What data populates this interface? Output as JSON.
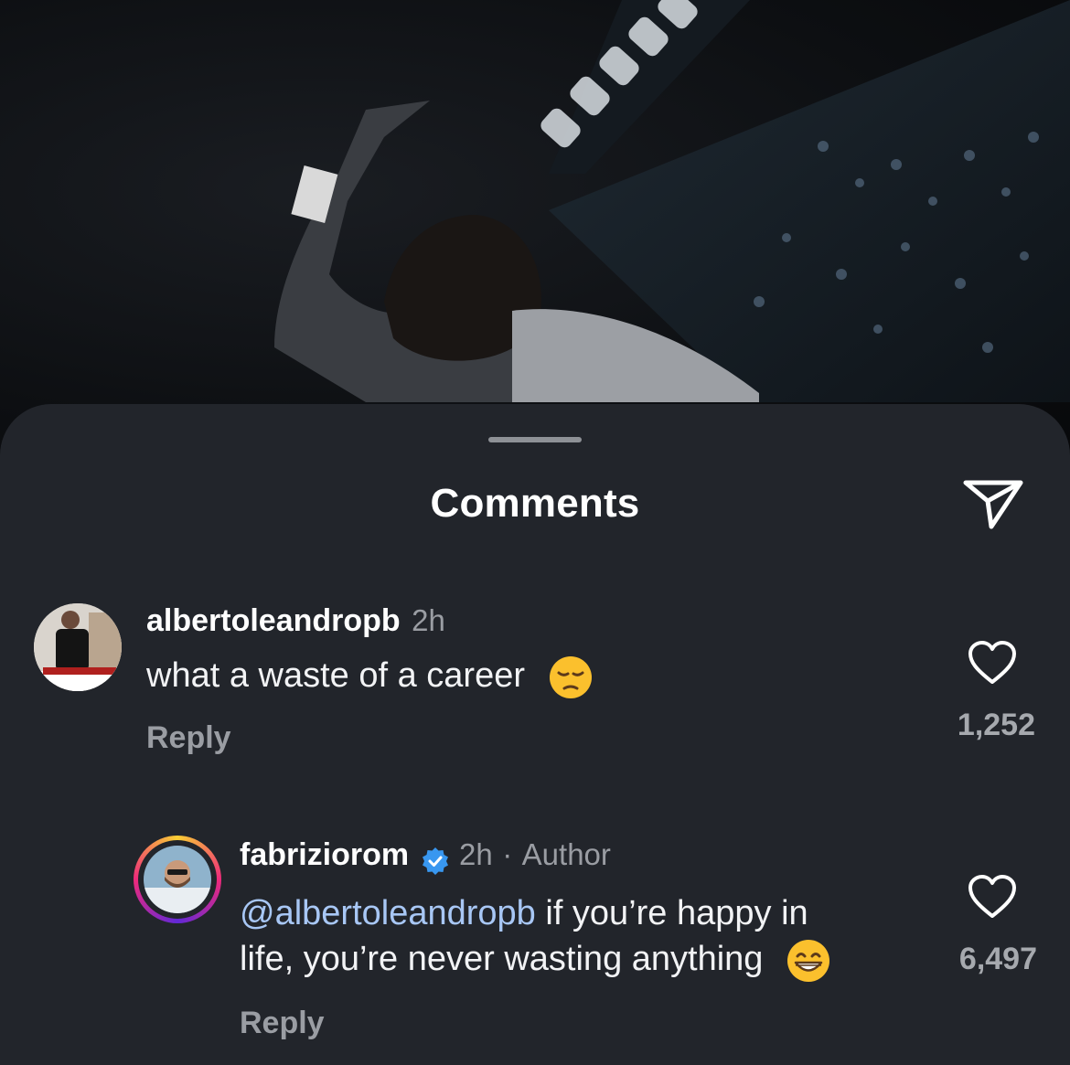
{
  "sheet": {
    "title": "Comments",
    "share_icon": "paper-plane-icon"
  },
  "comments": [
    {
      "username": "albertoleandropb",
      "time": "2h",
      "text": "what a waste of a career",
      "emoji": "pensive-face",
      "reply_label": "Reply",
      "like_icon": "heart-outline-icon",
      "like_count": "1,252"
    },
    {
      "username": "fabriziorom",
      "verified": true,
      "time": "2h",
      "separator": "·",
      "role": "Author",
      "mention": "@albertoleandropb",
      "text_line1": " if you’re happy in",
      "text_line2": "life, you’re never wasting anything",
      "emoji": "grinning-face-with-smiling-eyes",
      "reply_label": "Reply",
      "like_icon": "heart-outline-icon",
      "like_count": "6,497"
    }
  ],
  "colors": {
    "sheet_bg": "#22252b",
    "mention": "#a8c7f5",
    "verified": "#3897f0",
    "story_ring": [
      "#f9ce34",
      "#ee2a7b",
      "#6228d7"
    ]
  }
}
